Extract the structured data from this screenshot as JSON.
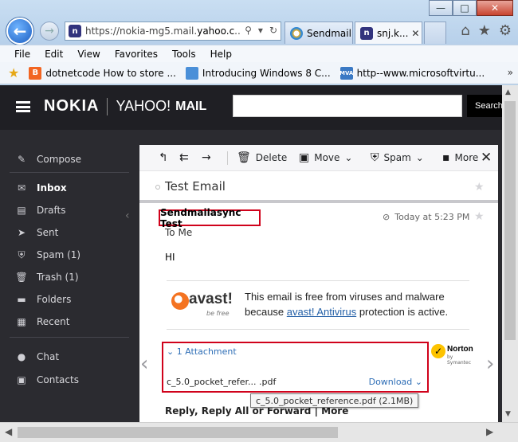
{
  "browser": {
    "address": {
      "prefix": "https://nokia-mg5.mail.",
      "host": "yahoo.c",
      "suffix": "..."
    },
    "tabs": [
      {
        "label": "Sendmail..."
      },
      {
        "label": "snj.k..."
      }
    ],
    "menu": [
      "File",
      "Edit",
      "View",
      "Favorites",
      "Tools",
      "Help"
    ],
    "favorites": [
      {
        "label": "dotnetcode How to store ..."
      },
      {
        "label": "Introducing Windows 8   C..."
      },
      {
        "label": "http--www.microsoftvirtu..."
      }
    ],
    "favicon_letter": "n",
    "mva_label": "MVA"
  },
  "mail": {
    "brand": {
      "nokia": "NOKIA",
      "yahoo": "YAHOO!",
      "mail": "MAIL"
    },
    "search_button": "Search",
    "sidebar": {
      "compose": "Compose",
      "folders": [
        {
          "label": "Inbox"
        },
        {
          "label": "Drafts"
        },
        {
          "label": "Sent"
        },
        {
          "label": "Spam (1)"
        },
        {
          "label": "Trash (1)"
        },
        {
          "label": "Folders"
        },
        {
          "label": "Recent"
        }
      ],
      "chat": "Chat",
      "contacts": "Contacts"
    },
    "toolbar": {
      "delete": "Delete",
      "move": "Move",
      "spam": "Spam",
      "more": "More"
    },
    "message": {
      "subject": "Test Email",
      "sender": "Sendmailasync Test",
      "date": "Today at 5:23 PM",
      "to_label": "To",
      "to": "Me",
      "body": "HI",
      "avast": {
        "logo": "avast!",
        "logo_sub": "be free",
        "line1": "This email is free from viruses and malware",
        "line2_pre": "because ",
        "link": "avast! Antivirus",
        "line2_post": " protection is active."
      },
      "attachment": {
        "header": "1 Attachment",
        "filename": "c_5.0_pocket_refer...  .pdf",
        "download": "Download"
      },
      "norton": {
        "name": "Norton",
        "sub": "by Symantec"
      },
      "reply_text": "Reply, Reply All or Forward | More",
      "tooltip": "c_5.0_pocket_reference.pdf (2.1MB)"
    }
  }
}
